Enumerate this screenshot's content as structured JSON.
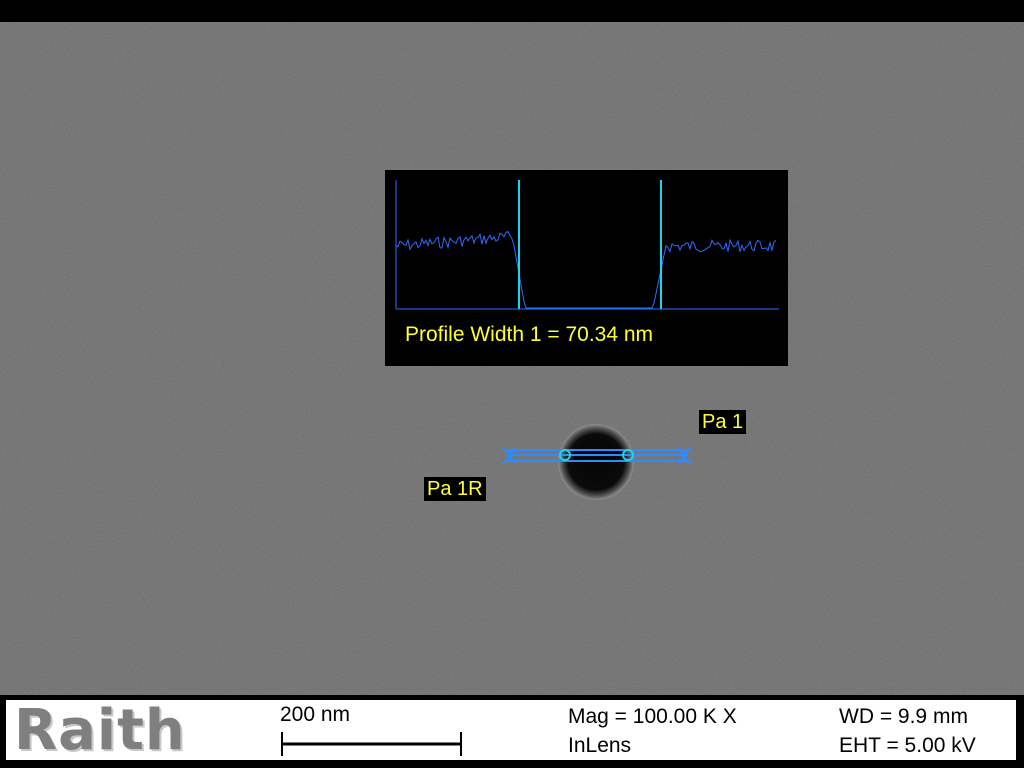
{
  "image": {
    "background_color": "#6e6e6e",
    "feature": "dark circular hole"
  },
  "profile_panel": {
    "label": "Profile Width 1 = 70.34 nm",
    "trace_color": "#2e6bff",
    "cursor_color": "#18d6ee",
    "label_color": "#ffff33"
  },
  "annotations": {
    "pa1": "Pa 1",
    "pa1r": "Pa 1R",
    "tool_color": "#2e8bff"
  },
  "info_bar": {
    "logo": "Raith",
    "scale_label": "200 nm",
    "mag": "Mag = 100.00 K X",
    "detector": "InLens",
    "wd": "WD =  9.9 mm",
    "eht": "EHT =  5.00 kV"
  }
}
